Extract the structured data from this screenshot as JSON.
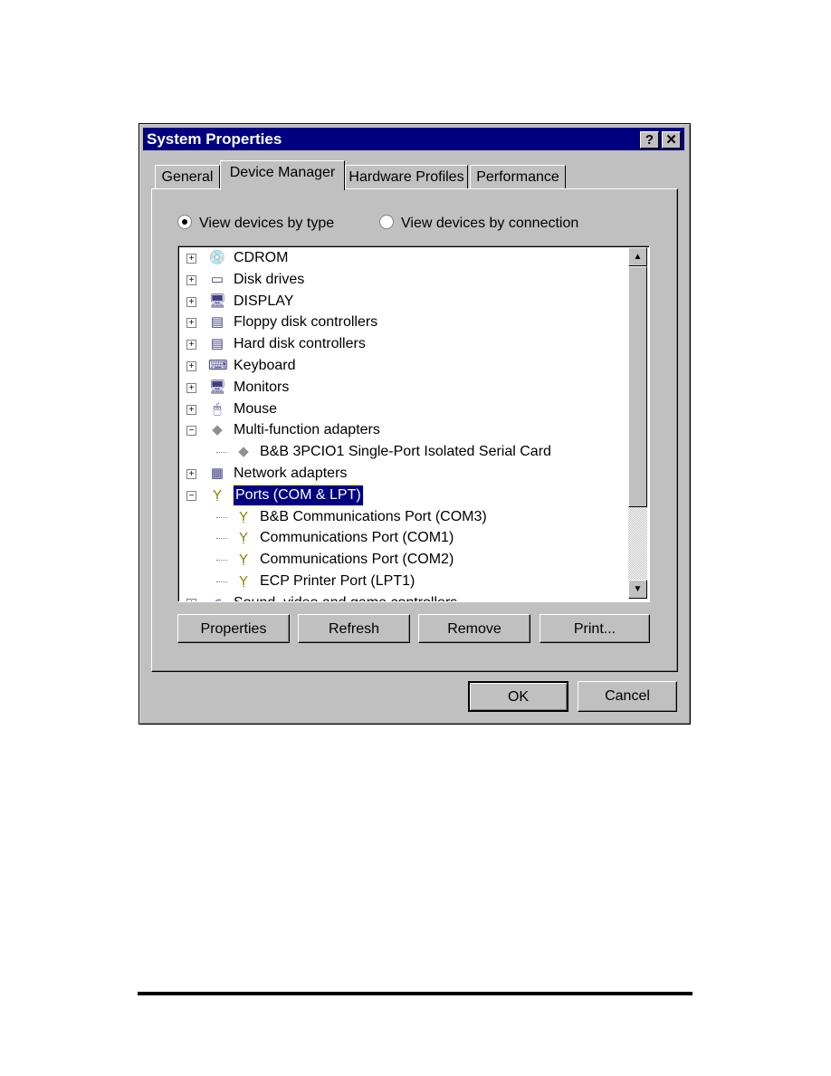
{
  "window": {
    "title": "System Properties",
    "help_label": "?",
    "close_label": "✕"
  },
  "tabs": [
    {
      "label": "General",
      "active": false
    },
    {
      "label": "Device Manager",
      "active": true
    },
    {
      "label": "Hardware Profiles",
      "active": false
    },
    {
      "label": "Performance",
      "active": false
    }
  ],
  "view_options": [
    {
      "label": "View devices by type",
      "checked": true
    },
    {
      "label": "View devices by connection",
      "checked": false
    }
  ],
  "tree": [
    {
      "label": "CDROM",
      "level": 0,
      "expander": "+",
      "icon": "cdrom-icon",
      "glyph": "💿"
    },
    {
      "label": "Disk drives",
      "level": 0,
      "expander": "+",
      "icon": "disk-drive-icon",
      "glyph": "▭"
    },
    {
      "label": "DISPLAY",
      "level": 0,
      "expander": "+",
      "icon": "display-icon",
      "glyph": "🖥"
    },
    {
      "label": "Floppy disk controllers",
      "level": 0,
      "expander": "+",
      "icon": "controller-icon",
      "glyph": "▤"
    },
    {
      "label": "Hard disk controllers",
      "level": 0,
      "expander": "+",
      "icon": "controller-icon",
      "glyph": "▤"
    },
    {
      "label": "Keyboard",
      "level": 0,
      "expander": "+",
      "icon": "keyboard-icon",
      "glyph": "⌨"
    },
    {
      "label": "Monitors",
      "level": 0,
      "expander": "+",
      "icon": "monitor-icon",
      "glyph": "🖥"
    },
    {
      "label": "Mouse",
      "level": 0,
      "expander": "+",
      "icon": "mouse-icon",
      "glyph": "🖱"
    },
    {
      "label": "Multi-function adapters",
      "level": 0,
      "expander": "−",
      "icon": "adapter-icon",
      "glyph": "◆"
    },
    {
      "label": "B&B 3PCIO1 Single-Port Isolated Serial Card",
      "level": 1,
      "icon": "adapter-icon",
      "glyph": "◆"
    },
    {
      "label": "Network adapters",
      "level": 0,
      "expander": "+",
      "icon": "network-adapter-icon",
      "glyph": "▦"
    },
    {
      "label": "Ports (COM & LPT)",
      "level": 0,
      "expander": "−",
      "icon": "port-icon",
      "glyph": "Ỵ",
      "selected": true
    },
    {
      "label": "B&B Communications Port (COM3)",
      "level": 1,
      "icon": "port-icon",
      "glyph": "Ỵ"
    },
    {
      "label": "Communications Port (COM1)",
      "level": 1,
      "icon": "port-icon",
      "glyph": "Ỵ"
    },
    {
      "label": "Communications Port (COM2)",
      "level": 1,
      "icon": "port-icon",
      "glyph": "Ỵ"
    },
    {
      "label": "ECP Printer Port (LPT1)",
      "level": 1,
      "icon": "port-icon",
      "glyph": "Ỵ"
    },
    {
      "label": "Sound, video and game controllers",
      "level": 0,
      "expander": "+",
      "icon": "sound-icon",
      "glyph": "♫"
    }
  ],
  "buttons": {
    "properties": "Properties",
    "refresh": "Refresh",
    "remove": "Remove",
    "print": "Print...",
    "ok": "OK",
    "cancel": "Cancel"
  },
  "colors": {
    "titlebar": "#000080",
    "face": "#c0c0c0",
    "selection": "#000080"
  }
}
